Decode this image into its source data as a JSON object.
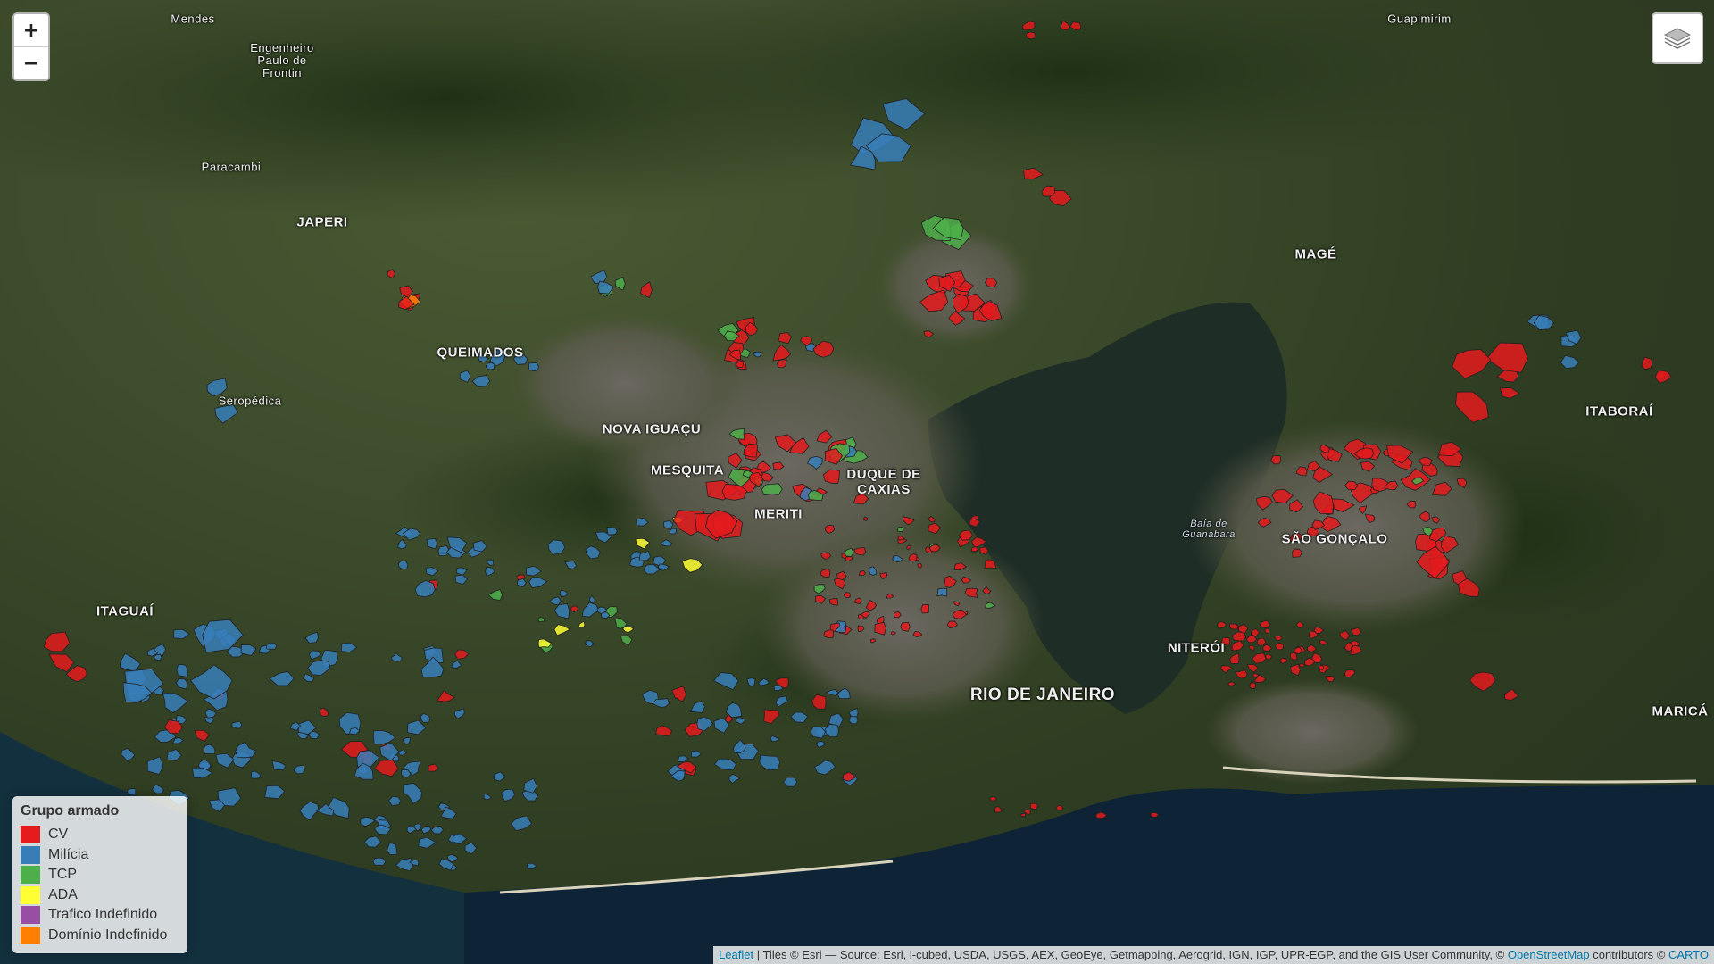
{
  "map": {
    "labels": [
      {
        "text": "Mendes",
        "size": "small"
      },
      {
        "text": "Engenheiro\nPaulo de\nFrontin",
        "size": "small"
      },
      {
        "text": "Paracambi",
        "size": "small"
      },
      {
        "text": "JAPERI",
        "size": "med"
      },
      {
        "text": "QUEIMADOS",
        "size": "med"
      },
      {
        "text": "Seropédica",
        "size": "small"
      },
      {
        "text": "NOVA IGUAÇU",
        "size": "med"
      },
      {
        "text": "MESQUITA",
        "size": "med"
      },
      {
        "text": "DUQUE DE\nCAXIAS",
        "size": "med"
      },
      {
        "text": "MERITI",
        "size": "med"
      },
      {
        "text": "ITAGUAÍ",
        "size": "med"
      },
      {
        "text": "MAGÉ",
        "size": "med"
      },
      {
        "text": "Guapimirim",
        "size": "small"
      },
      {
        "text": "ITABORAÍ",
        "size": "med"
      },
      {
        "text": "SÃO GONÇALO",
        "size": "med"
      },
      {
        "text": "NITERÓI",
        "size": "med"
      },
      {
        "text": "RIO DE JANEIRO",
        "size": "big"
      },
      {
        "text": "MARICÁ",
        "size": "med"
      },
      {
        "text": "Baía de\nGuanabara",
        "size": "water"
      }
    ],
    "zoom_in_label": "+",
    "zoom_out_label": "−",
    "layers_icon": "layers-icon"
  },
  "legend": {
    "title": "Grupo armado",
    "items": [
      {
        "label": "CV",
        "color": "#e41a1c"
      },
      {
        "label": "Milícia",
        "color": "#377eb8"
      },
      {
        "label": "TCP",
        "color": "#4daf4a"
      },
      {
        "label": "ADA",
        "color": "#ffff33"
      },
      {
        "label": "Trafico Indefinido",
        "color": "#984ea3"
      },
      {
        "label": "Domínio Indefinido",
        "color": "#ff7f00"
      }
    ]
  },
  "attribution": {
    "leaflet": "Leaflet",
    "tiles": " | Tiles © Esri — Source: Esri, i-cubed, USDA, USGS, AEX, GeoEye, Getmapping, Aerogrid, IGN, IGP, UPR-EGP, and the GIS User Community, © ",
    "osm": "OpenStreetMap",
    "contrib": " contributors © ",
    "carto": "CARTO"
  }
}
